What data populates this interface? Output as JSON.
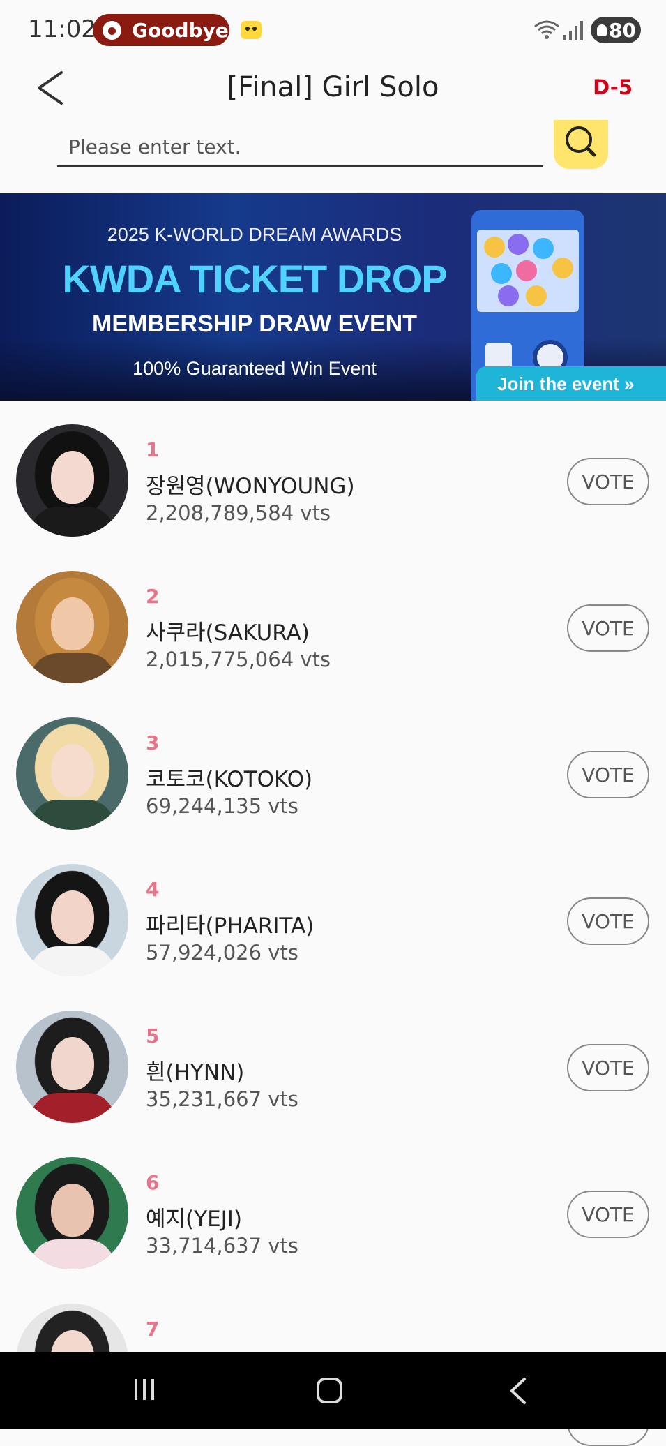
{
  "status_bar": {
    "time": "11:02",
    "notification_pill": "Goodbye",
    "battery": "80"
  },
  "header": {
    "title": "[Final] Girl Solo",
    "dday": "D-5"
  },
  "search": {
    "placeholder": "Please enter text."
  },
  "banner": {
    "line1": "2025 K-WORLD DREAM AWARDS",
    "line2": "KWDA TICKET DROP",
    "line3": "MEMBERSHIP DRAW EVENT",
    "line4": "100% Guaranteed Win Event",
    "join_label": "Join the event »"
  },
  "vote_label": "VOTE",
  "candidates": [
    {
      "rank": "1",
      "name": "장원영(WONYOUNG)",
      "votes": "2,208,789,584 vts",
      "avatar": {
        "bg": "#2a2a2e",
        "hair": "#111",
        "skin": "#f3d9cf",
        "cloth": "#1a1a1a"
      }
    },
    {
      "rank": "2",
      "name": "사쿠라(SAKURA)",
      "votes": "2,015,775,064 vts",
      "avatar": {
        "bg": "#b47a3a",
        "hair": "#c58a3f",
        "skin": "#f0c8a8",
        "cloth": "#6a4a2a"
      }
    },
    {
      "rank": "3",
      "name": "코토코(KOTOKO)",
      "votes": "69,244,135 vts",
      "avatar": {
        "bg": "#4b6b6a",
        "hair": "#f2dba6",
        "skin": "#f6dccd",
        "cloth": "#2e4c3e"
      }
    },
    {
      "rank": "4",
      "name": "파리타(PHARITA)",
      "votes": "57,924,026 vts",
      "avatar": {
        "bg": "#c9d6e0",
        "hair": "#151515",
        "skin": "#f2d5c8",
        "cloth": "#f4f4f4"
      }
    },
    {
      "rank": "5",
      "name": "흰(HYNN)",
      "votes": "35,231,667 vts",
      "avatar": {
        "bg": "#b8c2cc",
        "hair": "#1d1d1d",
        "skin": "#f0d6cc",
        "cloth": "#a3202a"
      }
    },
    {
      "rank": "6",
      "name": "예지(YEJI)",
      "votes": "33,714,637 vts",
      "avatar": {
        "bg": "#2f7a4f",
        "hair": "#1a1a1a",
        "skin": "#e8c3b0",
        "cloth": "#f3dde2"
      }
    },
    {
      "rank": "7",
      "name": "",
      "votes": "",
      "avatar": {
        "bg": "#e6e6e6",
        "hair": "#222",
        "skin": "#f2d9cd",
        "cloth": "#eee"
      }
    }
  ]
}
